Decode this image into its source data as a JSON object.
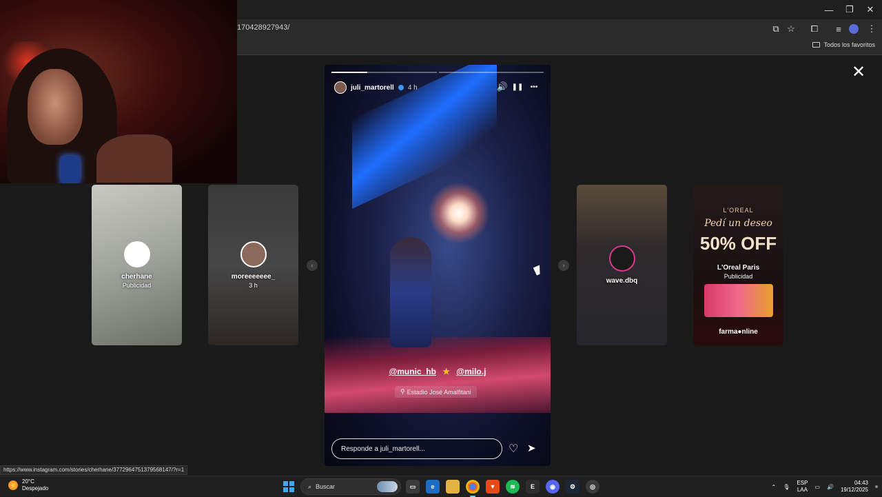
{
  "browser": {
    "url": "170428927943/",
    "bookmark_folder": "Todos los favoritos",
    "window_controls": {
      "minimize": "—",
      "restore": "❐",
      "close": "✕"
    }
  },
  "story_viewer": {
    "close_glyph": "✕",
    "prev_glyph": "‹",
    "next_glyph": "›",
    "main_story": {
      "username": "juli_martorell",
      "time": "4 h",
      "progress_fraction": 0.17,
      "mentions": [
        "@munic_hb",
        "@milo.j"
      ],
      "star": "★",
      "location": "Estadio José Amalfitani",
      "reply_placeholder": "Responde a juli_martorell...",
      "icons": {
        "mute": "🔊",
        "pause": "❚❚",
        "more": "•••",
        "heart": "♡",
        "send": "➤",
        "pin": "⚲"
      }
    },
    "side_stories": [
      {
        "name": "cherhane",
        "sub": "Publicidad"
      },
      {
        "name": "moreeeeeee_",
        "sub": "3 h"
      },
      {
        "name": "wave.dbq",
        "sub": ""
      },
      {
        "name": "L'Oreal Paris",
        "sub": "Publicidad",
        "label": "farma●nline",
        "brand": "L'OREAL",
        "script": "Pedí un deseo",
        "offer": "50% OFF"
      }
    ]
  },
  "status_link": "https://www.instagram.com/stories/cherhane/3772964751379568147/?r=1",
  "taskbar": {
    "weather_temp": "20°C",
    "weather_desc": "Despejado",
    "search_label": "Buscar",
    "lang_top": "ESP",
    "lang_bottom": "LAA",
    "time": "04:43",
    "date": "19/12/2025",
    "tray_arrow": "⌃",
    "mic": "🎙",
    "volume": "🔊",
    "network": "▭"
  },
  "colors": {
    "accent": "#60cdff",
    "instagram_verified": "#3b97f0",
    "star": "#f6c130"
  }
}
